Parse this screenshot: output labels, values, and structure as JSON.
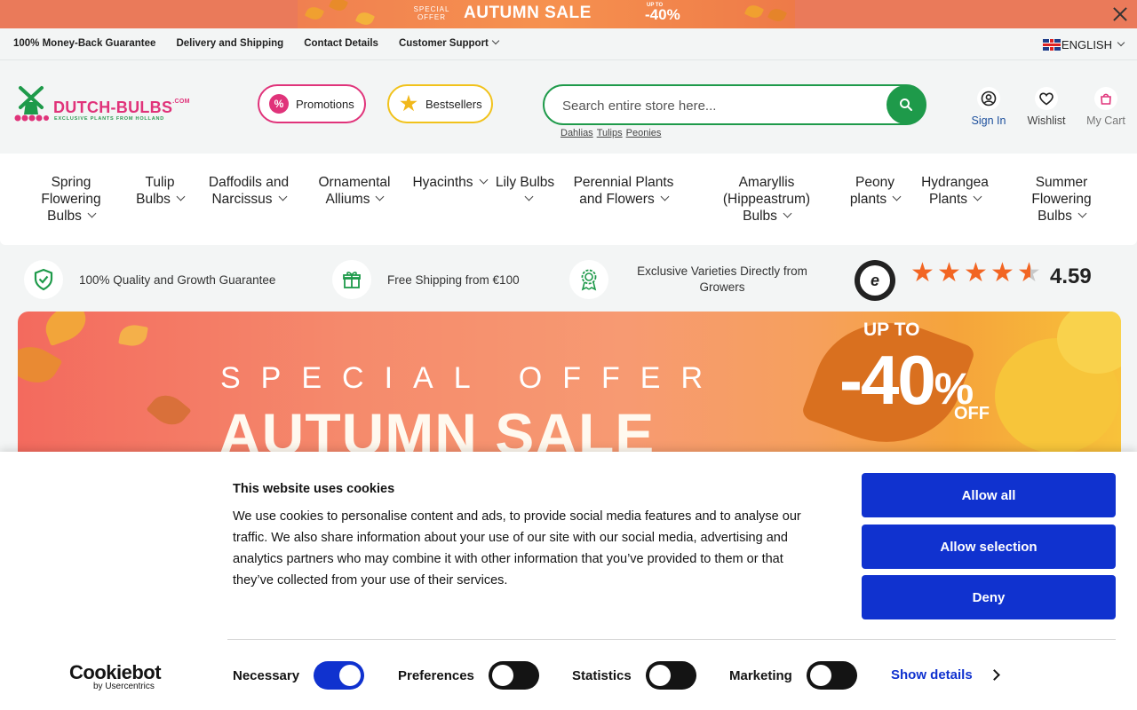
{
  "promo_strip": {
    "special_offer": "SPECIAL OFFER",
    "title": "AUTUMN SALE",
    "upto": "UP TO",
    "discount": "-40%"
  },
  "util_bar": {
    "links": [
      "100% Money-Back Guarantee",
      "Delivery and Shipping",
      "Contact Details",
      "Customer Support"
    ],
    "language": "ENGLISH"
  },
  "header": {
    "logo_name": "DUTCH-BULBS",
    "logo_suffix": ".COM",
    "logo_tagline": "EXCLUSIVE PLANTS FROM HOLLAND",
    "promotions_label": "Promotions",
    "bestsellers_label": "Bestsellers",
    "search_placeholder": "Search entire store here...",
    "quick_links": [
      "Dahlias",
      "Tulips",
      "Peonies"
    ],
    "account": {
      "signin": "Sign In",
      "wishlist": "Wishlist",
      "cart": "My Cart"
    }
  },
  "nav": {
    "items": [
      "Spring Flowering Bulbs",
      "Tulip Bulbs",
      "Daffodils and Narcissus",
      "Ornamental Alliums",
      "Hyacinths",
      "Lily Bulbs",
      "Perennial Plants and Flowers",
      "Amaryllis (Hippeastrum) Bulbs",
      "Peony plants",
      "Hydrangea Plants",
      "Summer Flowering Bulbs"
    ]
  },
  "trust": {
    "quality": "100% Quality and Growth Guarantee",
    "shipping": "Free Shipping from €100",
    "varieties": "Exclusive Varieties Directly from Growers",
    "rating": "4.59",
    "stars_value": 4.59,
    "stars_max": 5
  },
  "banner": {
    "special_offer": "SPECIAL OFFER",
    "title": "AUTUMN SALE",
    "upto": "UP TO",
    "discount": "-40",
    "percent": "%",
    "off": "OFF"
  },
  "cookie": {
    "title": "This website uses cookies",
    "body": "We use cookies to personalise content and ads, to provide social media features and to analyse our traffic. We also share information about your use of our site with our social media, advertising and analytics partners who may combine it with other information that you’ve provided to them or that they’ve collected from your use of their services.",
    "allow_all": "Allow all",
    "allow_selection": "Allow selection",
    "deny": "Deny",
    "brand": "Cookiebot",
    "brand_sub": "by Usercentrics",
    "toggles": {
      "necessary": "Necessary",
      "preferences": "Preferences",
      "statistics": "Statistics",
      "marketing": "Marketing"
    },
    "show_details": "Show details"
  },
  "colors": {
    "brand_pink": "#e0337a",
    "brand_green": "#1e9a4a",
    "star_orange": "#f26522",
    "cookie_blue": "#1032cf"
  }
}
